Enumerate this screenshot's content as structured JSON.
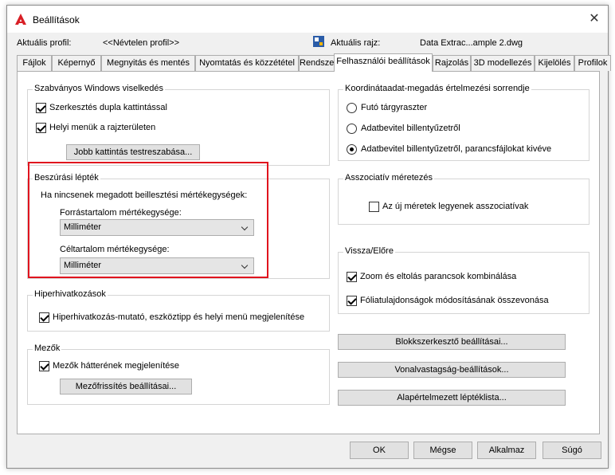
{
  "window": {
    "title": "Beállítások",
    "close_symbol": "✕"
  },
  "profile": {
    "current_profile_label": "Aktuális profil:",
    "current_profile_value": "<<Névtelen profil>>",
    "current_drawing_label": "Aktuális rajz:",
    "current_drawing_value": "Data Extrac...ample 2.dwg"
  },
  "tabs": [
    {
      "label": "Fájlok"
    },
    {
      "label": "Képernyő"
    },
    {
      "label": "Megnyitás és mentés"
    },
    {
      "label": "Nyomtatás és közzététel"
    },
    {
      "label": "Rendszer"
    },
    {
      "label": "Felhasználói beállítások",
      "active": true
    },
    {
      "label": "Rajzolás"
    },
    {
      "label": "3D modellezés"
    },
    {
      "label": "Kijelölés"
    },
    {
      "label": "Profilok"
    }
  ],
  "windows_behavior": {
    "title": "Szabványos Windows viselkedés",
    "double_click_edit": {
      "label": "Szerkesztés dupla kattintással",
      "checked": true
    },
    "shortcut_menus": {
      "label": "Helyi menük a rajzterületen",
      "checked": true
    },
    "right_click_button": "Jobb kattintás testreszabása..."
  },
  "insertion_scale": {
    "title": "Beszúrási lépték",
    "description": "Ha nincsenek megadott beillesztési mértékegységek:",
    "source_label": "Forrástartalom mértékegysége:",
    "source_value": "Milliméter",
    "target_label": "Céltartalom mértékegysége:",
    "target_value": "Milliméter"
  },
  "hyperlink": {
    "title": "Hiperhivatkozások",
    "display": {
      "label": "Hiperhivatkozás-mutató, eszköztipp és helyi menü megjelenítése",
      "checked": true
    }
  },
  "fields": {
    "title": "Mezők",
    "background": {
      "label": "Mezők hátterének megjelenítése",
      "checked": true
    },
    "update_settings_button": "Mezőfrissítés beállításai..."
  },
  "coordinate_priority": {
    "title": "Koordinátaadat-megadás értelmezési sorrendje",
    "options": [
      {
        "label": "Futó tárgyraszter",
        "checked": false
      },
      {
        "label": "Adatbevitel billentyűzetről",
        "checked": false
      },
      {
        "label": "Adatbevitel billentyűzetről, parancsfájlokat kivéve",
        "checked": true
      }
    ]
  },
  "associative_dimensioning": {
    "title": "Asszociatív méretezés",
    "new_associative": {
      "label": "Az új méretek legyenek asszociatívak",
      "checked": false
    }
  },
  "undo_redo": {
    "title": "Vissza/Előre",
    "combine_zoom_pan": {
      "label": "Zoom és eltolás parancsok kombinálása",
      "checked": true
    },
    "combine_layer": {
      "label": "Fóliatulajdonságok módosításának összevonása",
      "checked": true
    }
  },
  "side_buttons": {
    "block_editor": "Blokkszerkesztő beállításai...",
    "lineweight": "Vonalvastagság-beállítások...",
    "default_scale_list": "Alapértelmezett léptéklista..."
  },
  "footer": {
    "ok": "OK",
    "cancel": "Mégse",
    "apply": "Alkalmaz",
    "help": "Súgó"
  },
  "colors": {
    "highlight_border": "#e0141e",
    "app_icon": "#d81f26",
    "dialog_bg": "#f0f0f0",
    "button_bg": "#e1e1e1"
  },
  "icons": {
    "app": "autocad-a-icon",
    "drawing": "dwg-file-icon",
    "close": "close-icon"
  }
}
